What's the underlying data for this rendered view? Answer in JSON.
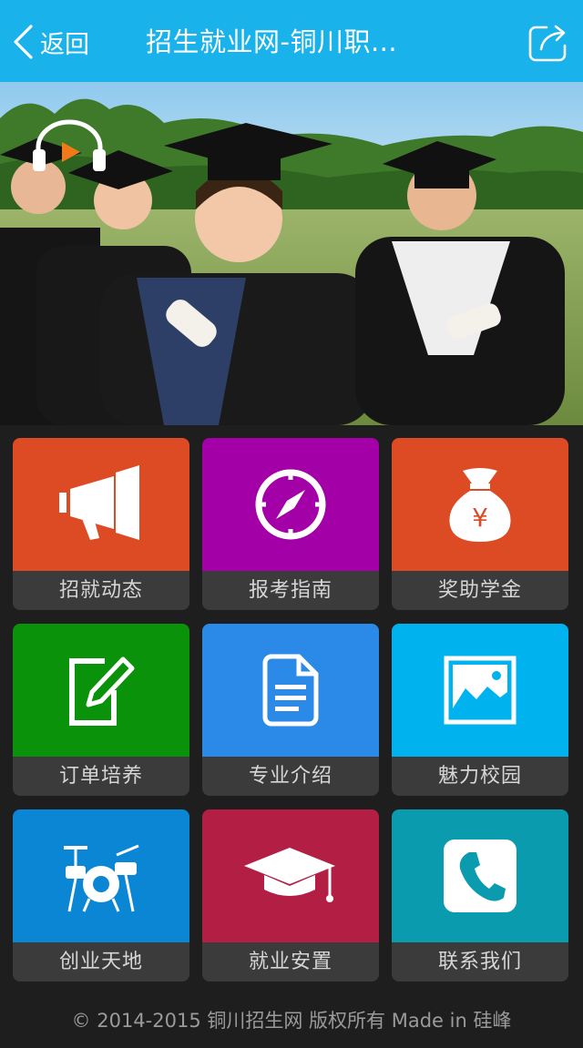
{
  "header": {
    "back_label": "返回",
    "title": "招生就业网-铜川职..."
  },
  "tiles": [
    {
      "label": "招就动态",
      "color": "#dc4b23",
      "icon": "megaphone-icon"
    },
    {
      "label": "报考指南",
      "color": "#a400a8",
      "icon": "compass-icon"
    },
    {
      "label": "奖助学金",
      "color": "#dc4b23",
      "icon": "money-bag-icon"
    },
    {
      "label": "订单培养",
      "color": "#0a930a",
      "icon": "edit-icon"
    },
    {
      "label": "专业介绍",
      "color": "#2b8ae8",
      "icon": "document-icon"
    },
    {
      "label": "魅力校园",
      "color": "#00b3ee",
      "icon": "picture-icon"
    },
    {
      "label": "创业天地",
      "color": "#0a86d4",
      "icon": "drum-kit-icon"
    },
    {
      "label": "就业安置",
      "color": "#b31e45",
      "icon": "graduation-cap-icon"
    },
    {
      "label": "联系我们",
      "color": "#0a9baf",
      "icon": "phone-icon"
    }
  ],
  "money_symbol": "¥",
  "footer": "© 2014-2015 铜川招生网 版权所有 Made in 硅峰"
}
